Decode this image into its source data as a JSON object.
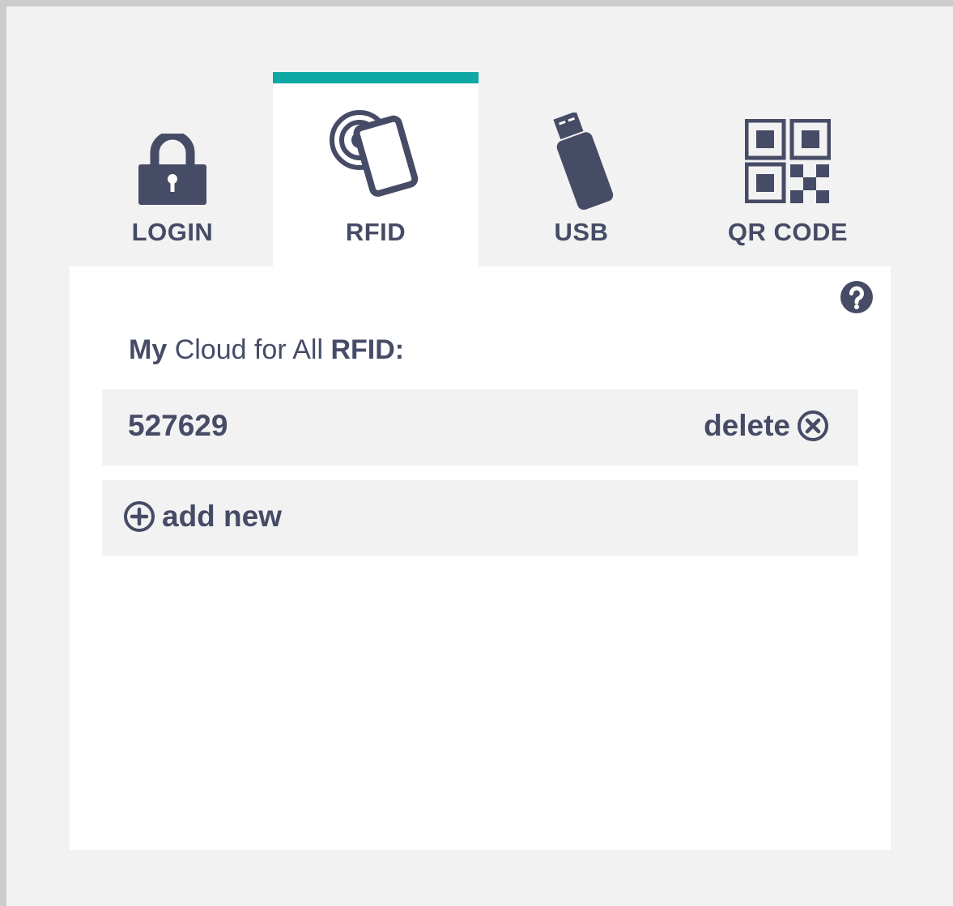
{
  "tabs": [
    {
      "label": "LOGIN",
      "icon": "lock-icon",
      "active": false
    },
    {
      "label": "RFID",
      "icon": "rfid-card-icon",
      "active": true
    },
    {
      "label": "USB",
      "icon": "usb-stick-icon",
      "active": false
    },
    {
      "label": "QR CODE",
      "icon": "qr-code-icon",
      "active": false
    }
  ],
  "panel": {
    "title_bold_1": "My",
    "title_regular": "Cloud for All",
    "title_bold_2": "RFID:",
    "items": [
      {
        "value": "527629",
        "delete_label": "delete"
      }
    ],
    "add_label": "add new",
    "help_icon": "help-icon"
  },
  "colors": {
    "accent": "#0fa8a5",
    "text": "#464b66",
    "background": "#f2f2f2",
    "panel": "#ffffff"
  }
}
